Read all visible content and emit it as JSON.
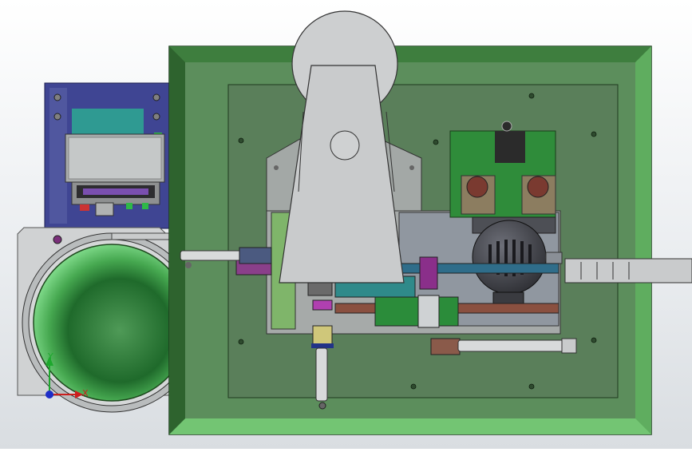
{
  "scene": {
    "triad": {
      "x_label": "X",
      "y_label": "Y"
    }
  },
  "colors": {
    "background": "#eef0f2",
    "tray_outer": "#3f8a3f",
    "tray_inner": "#5a7f5a",
    "plate": "#a3a8a6",
    "arm": "#c9cbcc",
    "bowl_rim": "#b4b6b7",
    "bowl_inner": "#3a8a45",
    "motor": "#4a4a50",
    "green_board": "#2f8c3a",
    "blue_frame": "#4a4f9a",
    "axis_x": "#cc1e1e",
    "axis_y": "#1ea82e",
    "axis_z": "#1e2ec8"
  }
}
